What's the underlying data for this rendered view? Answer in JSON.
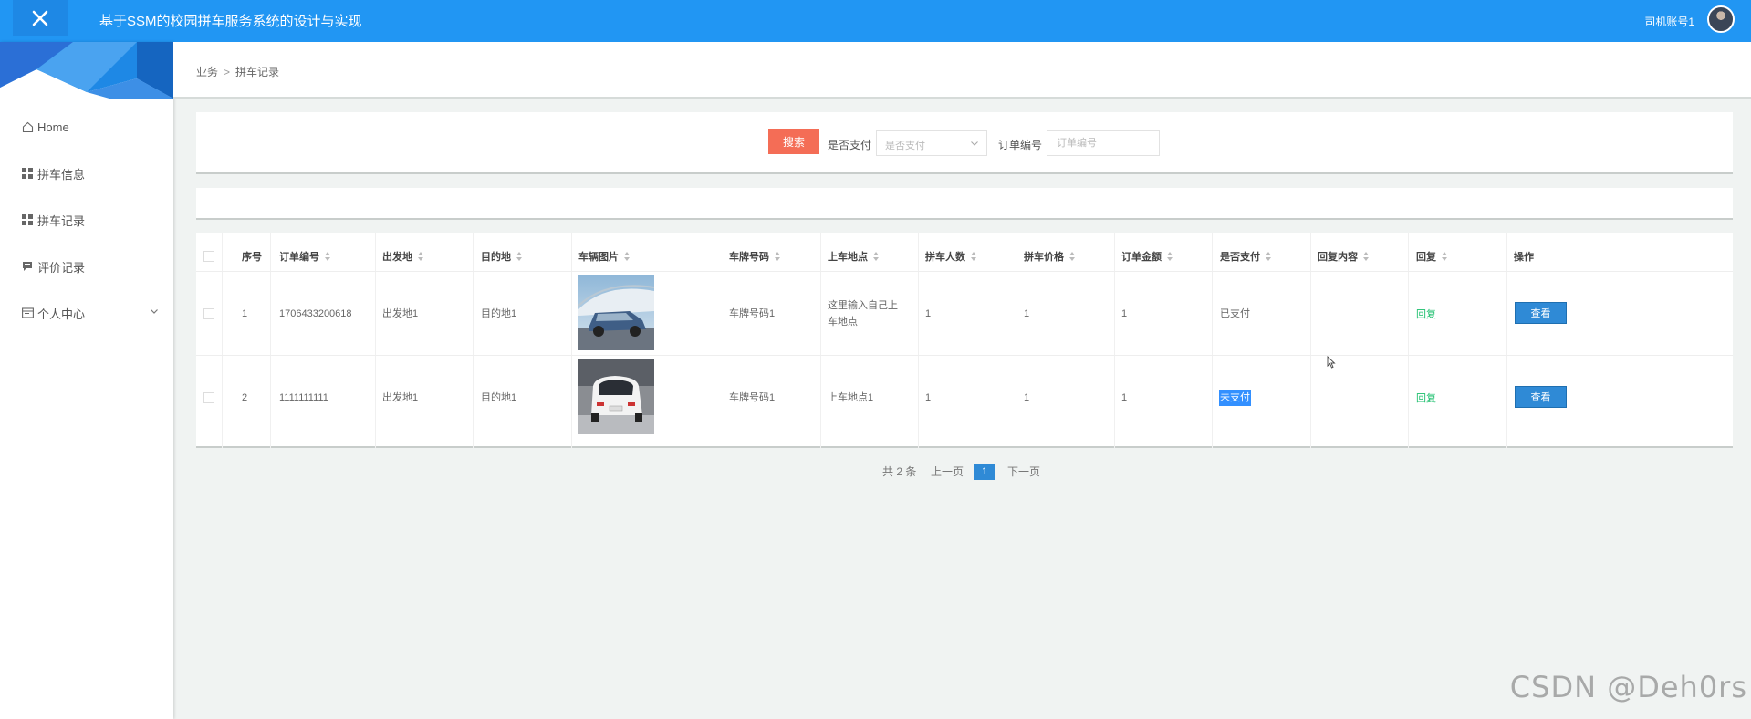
{
  "header": {
    "title": "基于SSM的校园拼车服务系统的设计与实现",
    "user": "司机账号1"
  },
  "sidebar": {
    "items": [
      {
        "label": "Home",
        "icon": "home-icon"
      },
      {
        "label": "拼车信息",
        "icon": "grid-icon"
      },
      {
        "label": "拼车记录",
        "icon": "grid-icon"
      },
      {
        "label": "评价记录",
        "icon": "comment-icon"
      },
      {
        "label": "个人中心",
        "icon": "id-card-icon"
      }
    ]
  },
  "breadcrumb": {
    "parent": "业务",
    "separator": ">",
    "current": "拼车记录"
  },
  "search": {
    "button_label": "搜索",
    "paid_label": "是否支付",
    "paid_placeholder": "是否支付",
    "order_label": "订单编号",
    "order_placeholder": "订单编号"
  },
  "table": {
    "columns": [
      "序号",
      "订单编号",
      "出发地",
      "目的地",
      "车辆图片",
      "车牌号码",
      "上车地点",
      "拼车人数",
      "拼车价格",
      "订单金额",
      "是否支付",
      "回复内容",
      "回复",
      "操作"
    ],
    "rows": [
      {
        "index": "1",
        "order_no": "1706433200618",
        "origin": "出发地1",
        "destination": "目的地1",
        "plate": "车牌号码1",
        "pickup": "这里输入自己上车地点",
        "people": "1",
        "price": "1",
        "amount": "1",
        "paid": "已支付",
        "reply_content": "",
        "reply_link": "回复",
        "action": "查看"
      },
      {
        "index": "2",
        "order_no": "1111111111",
        "origin": "出发地1",
        "destination": "目的地1",
        "plate": "车牌号码1",
        "pickup": "上车地点1",
        "people": "1",
        "price": "1",
        "amount": "1",
        "paid": "未支付",
        "reply_content": "",
        "reply_link": "回复",
        "action": "查看"
      }
    ]
  },
  "pagination": {
    "total": "共 2 条",
    "prev": "上一页",
    "current": "1",
    "next": "下一页"
  },
  "watermark": "CSDN @Deh0rs",
  "colors": {
    "header": "#2196f3",
    "search_button": "#f46d56",
    "view_button": "#2f8ad6",
    "reply_link": "#19be6b"
  }
}
